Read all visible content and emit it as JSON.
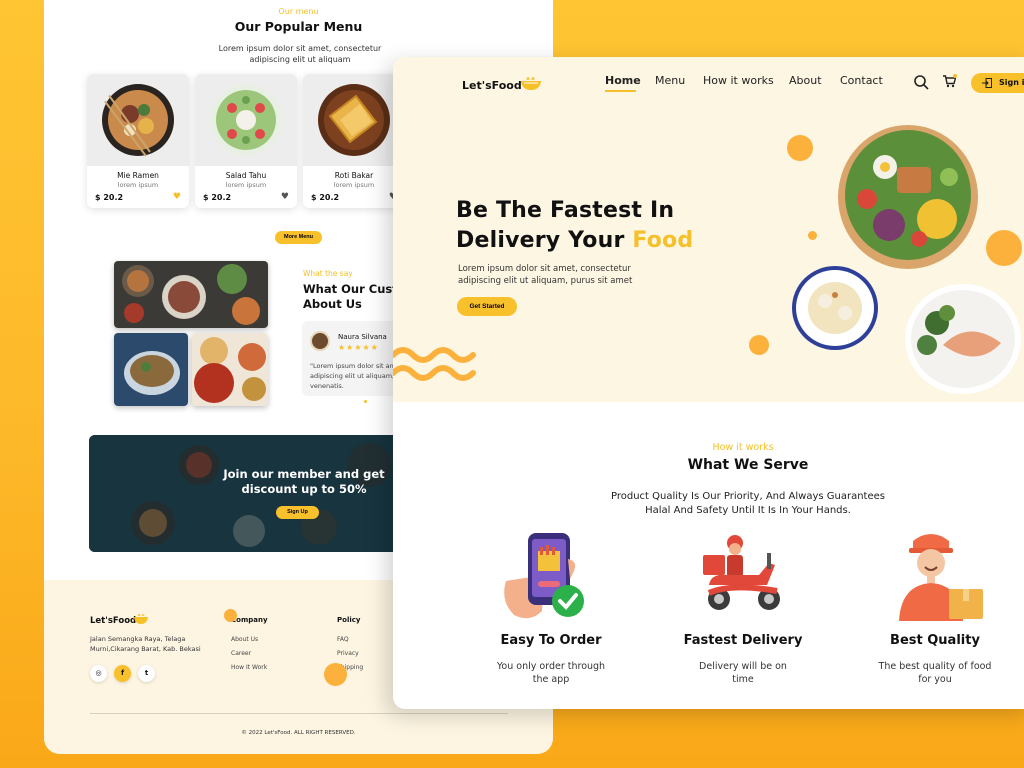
{
  "menu_page": {
    "eyebrow": "Our menu",
    "title": "Our Popular Menu",
    "subtitle_line1": "Lorem ipsum dolor sit amet, consectetur",
    "subtitle_line2": "adipiscing elit ut aliquam",
    "dishes": [
      {
        "name": "Mie Ramen",
        "sub": "lorem ipsum",
        "price": "$ 20.2",
        "favorited": true
      },
      {
        "name": "Salad Tahu",
        "sub": "lorem ipsum",
        "price": "$ 20.2",
        "favorited": false
      },
      {
        "name": "Roti Bakar",
        "sub": "lorem ipsum",
        "price": "$ 20.2",
        "favorited": false
      }
    ],
    "more_button": "More Menu",
    "testimonial": {
      "eyebrow": "What the say",
      "title_line1": "What Our Custo",
      "title_line2": "About Us",
      "name": "Naura Silvana",
      "stars": "★★★★★",
      "quote_line1": "\"Lorem ipsum dolor sit ame",
      "quote_line2": "adipiscing elit ut aliquam,",
      "quote_line3": "venenatis."
    },
    "member_line1": "Join our member and get",
    "member_line2": "discount up to 50%",
    "signup_button": "Sign Up",
    "footer": {
      "logo": "Let'sFood",
      "address_line1": "Jalan Semangka Raya, Telaga",
      "address_line2": "Murni,Cikarang Barat, Kab. Bekasi",
      "social": [
        "instagram-icon",
        "facebook-icon",
        "twitter-icon"
      ],
      "social_glyphs": [
        "◎",
        "f",
        "t"
      ],
      "company_title": "Company",
      "company_links": [
        "About Us",
        "Career",
        "How It Work"
      ],
      "policy_title": "Policy",
      "policy_links": [
        "FAQ",
        "Privacy",
        "Shipping"
      ],
      "copyright": "© 2022 Let'sFood. ALL RIGHT RESERVED."
    }
  },
  "home_page": {
    "logo": "Let'sFood",
    "nav": [
      "Home",
      "Menu",
      "How it works",
      "About",
      "Contact"
    ],
    "active_nav": "Home",
    "signin": "Sign in",
    "hero_title_line1": "Be The Fastest In",
    "hero_title_line2_plain": "Delivery Your ",
    "hero_title_line2_accent": "Food",
    "hero_desc_line1": "Lorem ipsum dolor sit amet, consectetur",
    "hero_desc_line2": "adipiscing elit ut aliquam, purus sit amet",
    "cta": "Get Started",
    "section_eyebrow": "How it works",
    "section_title": "What We Serve",
    "section_desc_line1": "Product Quality Is Our Priority, And Always Guarantees",
    "section_desc_line2": "Halal And Safety Until It Is In Your Hands.",
    "features": [
      {
        "title": "Easy To Order",
        "desc_line1": "You only order through",
        "desc_line2": "the app"
      },
      {
        "title": "Fastest Delivery",
        "desc_line1": "Delivery will be on",
        "desc_line2": "time"
      },
      {
        "title": "Best Quality",
        "desc_line1": "The best quality of food",
        "desc_line2": "for you"
      }
    ]
  },
  "colors": {
    "accent": "#f5c02a",
    "button": "#f8c12b",
    "orange": "#fbb13c",
    "hero_bg": "#fdf6e3",
    "page_bg": "#ffc533"
  }
}
